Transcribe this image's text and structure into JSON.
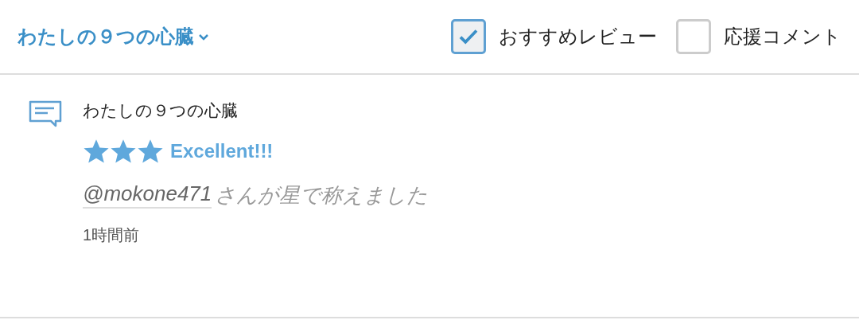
{
  "header": {
    "title": "わたしの９つの心臓",
    "filters": [
      {
        "label": "おすすめレビュー",
        "checked": true
      },
      {
        "label": "応援コメント",
        "checked": false
      }
    ]
  },
  "activity": {
    "work_title": "わたしの９つの心臓",
    "stars": 3,
    "rating_label": "Excellent!!!",
    "user": "@mokone471",
    "message": "さんが星で称えました",
    "time": "1時間前"
  }
}
